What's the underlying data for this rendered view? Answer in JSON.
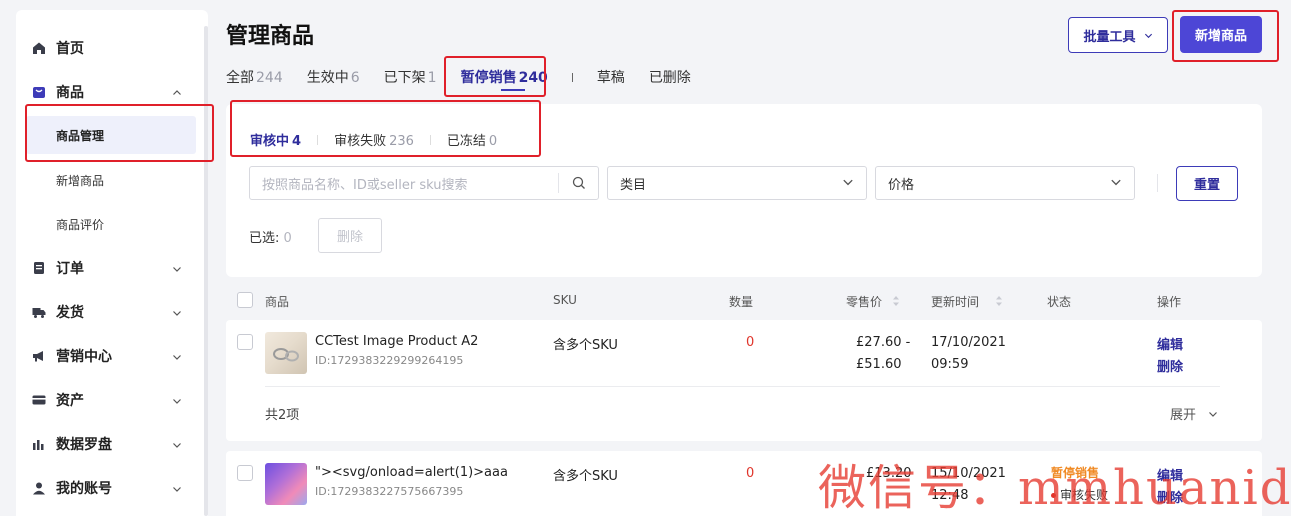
{
  "sidebar": {
    "items": [
      {
        "label": "首页",
        "icon": "home-icon"
      },
      {
        "label": "商品",
        "icon": "product-icon",
        "expanded": true,
        "children": [
          "商品管理",
          "新增商品",
          "商品评价"
        ]
      },
      {
        "label": "订单",
        "icon": "order-icon"
      },
      {
        "label": "发货",
        "icon": "truck-icon"
      },
      {
        "label": "营销中心",
        "icon": "megaphone-icon"
      },
      {
        "label": "资产",
        "icon": "card-icon"
      },
      {
        "label": "数据罗盘",
        "icon": "bar-chart-icon"
      },
      {
        "label": "我的账号",
        "icon": "user-icon"
      }
    ],
    "active": "商品管理"
  },
  "header": {
    "title": "管理商品",
    "batch_tools_label": "批量工具",
    "add_product_label": "新增商品"
  },
  "tabs": [
    {
      "label": "全部",
      "count": "244"
    },
    {
      "label": "生效中",
      "count": "6"
    },
    {
      "label": "已下架",
      "count": "1"
    },
    {
      "label": "暂停销售",
      "count": "240",
      "active": true
    },
    {
      "label": "草稿",
      "count": ""
    },
    {
      "label": "已删除",
      "count": ""
    }
  ],
  "subtabs": [
    {
      "label": "审核中",
      "count": "4",
      "active": true
    },
    {
      "label": "审核失败",
      "count": "236"
    },
    {
      "label": "已冻结",
      "count": "0"
    }
  ],
  "filters": {
    "search_placeholder": "按照商品名称、ID或seller sku搜索",
    "category_label": "类目",
    "price_label": "价格",
    "reset_label": "重置",
    "selected_label": "已选:",
    "selected_count": "0",
    "delete_label": "删除"
  },
  "table": {
    "headers": {
      "product": "商品",
      "sku": "SKU",
      "quantity": "数量",
      "price": "零售价",
      "updated": "更新时间",
      "status": "状态",
      "actions": "操作"
    },
    "rows": [
      {
        "name": "CCTest Image Product A2",
        "id": "ID:1729383229299264195",
        "sku": "含多个SKU",
        "quantity": "0",
        "price_line1": "£27.60 -",
        "price_line2": "£51.60",
        "updated_line1": "17/10/2021",
        "updated_line2": "09:59",
        "status_tag": "",
        "status_sub": "",
        "edit": "编辑",
        "delete": "删除",
        "footer_count": "共2项",
        "footer_expand": "展开"
      },
      {
        "name": "\"><svg/onload=alert(1)>aaa",
        "id": "ID:1729383227575667395",
        "sku": "含多个SKU",
        "quantity": "0",
        "price_line1": "£13.20",
        "updated_line1": "15/10/2021",
        "updated_line2": "12:48",
        "status_tag": "暂停销售",
        "status_sub": "审核失败",
        "edit": "编辑",
        "delete": "删除"
      }
    ]
  },
  "watermark": "微信号：mmhuanidc",
  "colors": {
    "accent": "#4d46d6",
    "accent_text": "#2f2d9c",
    "danger": "#e0352b",
    "annotation": "#e0202a"
  }
}
